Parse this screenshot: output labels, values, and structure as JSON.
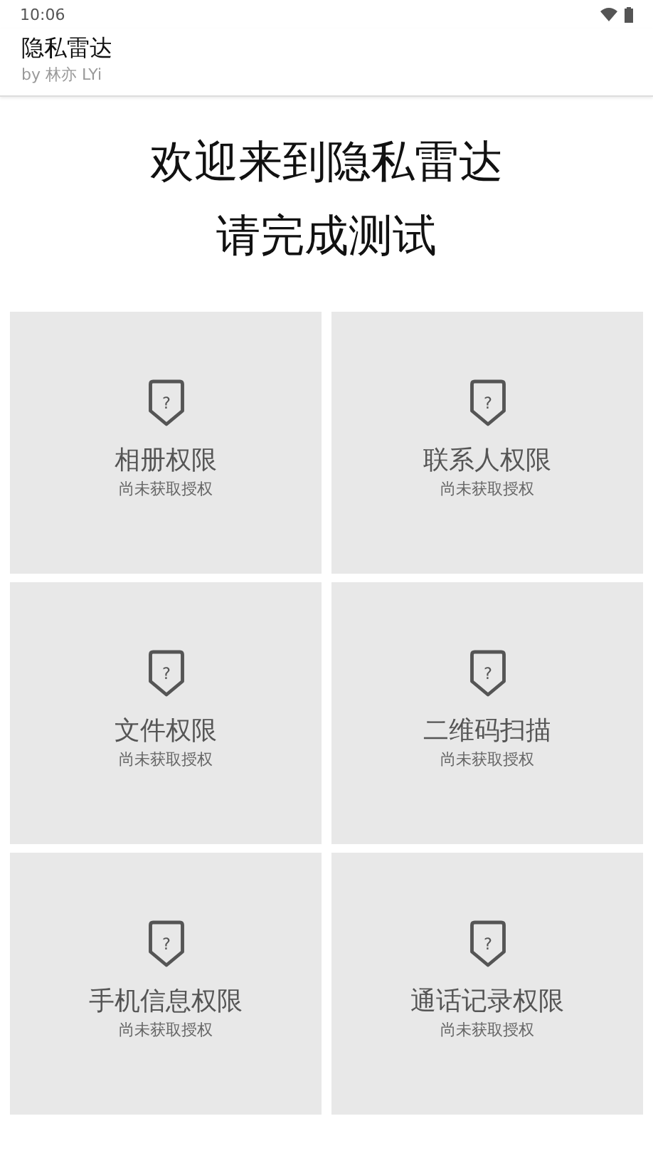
{
  "status_bar": {
    "time": "10:06"
  },
  "app_bar": {
    "title": "隐私雷达",
    "subtitle": "by 林亦 LYi"
  },
  "heading": [
    "欢迎来到隐私雷达",
    "请完成测试"
  ],
  "permissions": [
    {
      "name": "相册权限",
      "status": "尚未获取授权",
      "icon_glyph": "?"
    },
    {
      "name": "联系人权限",
      "status": "尚未获取授权",
      "icon_glyph": "?"
    },
    {
      "name": "文件权限",
      "status": "尚未获取授权",
      "icon_glyph": "?"
    },
    {
      "name": "二维码扫描",
      "status": "尚未获取授权",
      "icon_glyph": "?"
    },
    {
      "name": "手机信息权限",
      "status": "尚未获取授权",
      "icon_glyph": "?"
    },
    {
      "name": "通话记录权限",
      "status": "尚未获取授权",
      "icon_glyph": "?"
    }
  ]
}
